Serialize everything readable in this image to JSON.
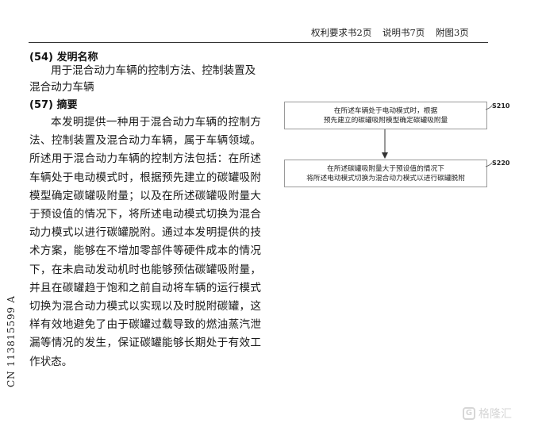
{
  "header": {
    "claims_pages": "权利要求书2页",
    "description_pages": "说明书7页",
    "drawings_pages": "附图3页"
  },
  "title_section": {
    "heading": "(54) 发明名称",
    "text": "用于混合动力车辆的控制方法、控制装置及混合动力车辆"
  },
  "abstract_section": {
    "heading": "(57) 摘要",
    "text": "本发明提供一种用于混合动力车辆的控制方法、控制装置及混合动力车辆，属于车辆领域。所述用于混合动力车辆的控制方法包括：在所述车辆处于电动模式时，根据预先建立的碳罐吸附模型确定碳罐吸附量；以及在所述碳罐吸附量大于预设值的情况下，将所述电动模式切换为混合动力模式以进行碳罐脱附。通过本发明提供的技术方案，能够在不增加零部件等硬件成本的情况下，在未启动发动机时也能够预估碳罐吸附量，并且在碳罐趋于饱和之前自动将车辆的运行模式切换为混合动力模式以实现以及时脱附碳罐，这样有效地避免了由于碳罐过载导致的燃油蒸汽泄漏等情况的发生，保证碳罐能够长期处于有效工作状态。"
  },
  "publication_number": "CN 113815599 A",
  "flowchart": {
    "step1": {
      "label": "S210",
      "line1": "在所述车辆处于电动模式时，根据",
      "line2": "预先建立的碳罐吸附模型确定碳罐吸附量"
    },
    "step2": {
      "label": "S220",
      "line1": "在所述碳罐吸附量大于预设值的情况下",
      "line2": "将所述电动模式切换为混合动力模式以进行碳罐脱附"
    }
  },
  "watermark": {
    "logo_glyph": "G",
    "text": "格隆汇"
  }
}
